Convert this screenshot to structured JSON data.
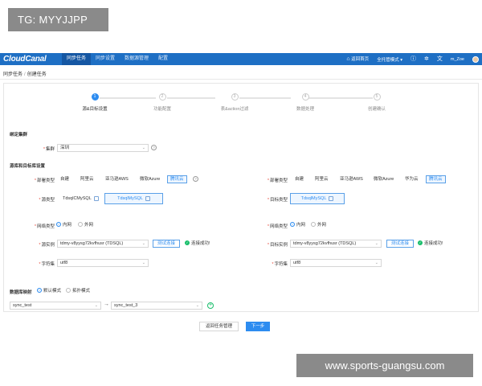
{
  "overlay": {
    "tg": "TG: MYYJJPP",
    "watermark": "www.sports-guangsu.com"
  },
  "nav": {
    "logo": "CloudCanal",
    "menu": [
      "同步任务",
      "同步设置",
      "数据源管理",
      "配置"
    ],
    "right": {
      "home": "返回首页",
      "mode": "全托管模式",
      "mode_caret": "▾",
      "user": "m_Zoe"
    }
  },
  "breadcrumb": {
    "parent": "同步任务",
    "sep": "/",
    "current": "创建任务"
  },
  "steps": [
    {
      "num": "1",
      "label": "源&目标设置"
    },
    {
      "num": "2",
      "label": "功能配置"
    },
    {
      "num": "3",
      "label": "表&action过滤"
    },
    {
      "num": "4",
      "label": "数据处理"
    },
    {
      "num": "5",
      "label": "创建确认"
    }
  ],
  "cluster": {
    "section": "绑定集群",
    "label": "集群",
    "value": "深圳"
  },
  "dbsection": {
    "title": "源库和目标库设置"
  },
  "source": {
    "deploy_label": "部署类型",
    "deploy_options": [
      "自建",
      "阿里云",
      "亚马逊AWS",
      "微软Azure",
      "腾讯云"
    ],
    "type_label": "源类型",
    "types": [
      "TdsqlCMySQL",
      "TdsqlMySQL"
    ],
    "net_label": "网络类型",
    "net_options": [
      "内网",
      "外网"
    ],
    "instance_label": "源实例",
    "instance_value": "tdmy-v8yysg72kvfhusr (TDSQL)",
    "test_button": "测试连接",
    "conn_ok": "连接成功!",
    "charset_label": "字符集",
    "charset_value": "utf8"
  },
  "target": {
    "deploy_label": "部署类型",
    "deploy_options": [
      "自建",
      "阿里云",
      "亚马逊AWS",
      "微软Azure",
      "华为云",
      "腾讯云"
    ],
    "type_label": "目标类型",
    "types": [
      "TdsqlMySQL"
    ],
    "net_label": "网络类型",
    "net_options": [
      "内网",
      "外网"
    ],
    "instance_label": "目标实例",
    "instance_value": "tdmy-v8yysg72kvfhusr (TDSQL)",
    "test_button": "测试连接",
    "conn_ok": "连接成功!",
    "charset_label": "字符集",
    "charset_value": "utf8"
  },
  "mapping": {
    "label": "数据库映射",
    "modes": [
      "默认模式",
      "拓扑模式"
    ],
    "source_db": "sync_test",
    "target_db": "sync_test_3"
  },
  "footer": {
    "back": "返回任务管理",
    "next": "下一步"
  },
  "colors": {
    "nav": "#1e6fc4",
    "primary": "#2d8cf0",
    "success": "#19be6b"
  }
}
